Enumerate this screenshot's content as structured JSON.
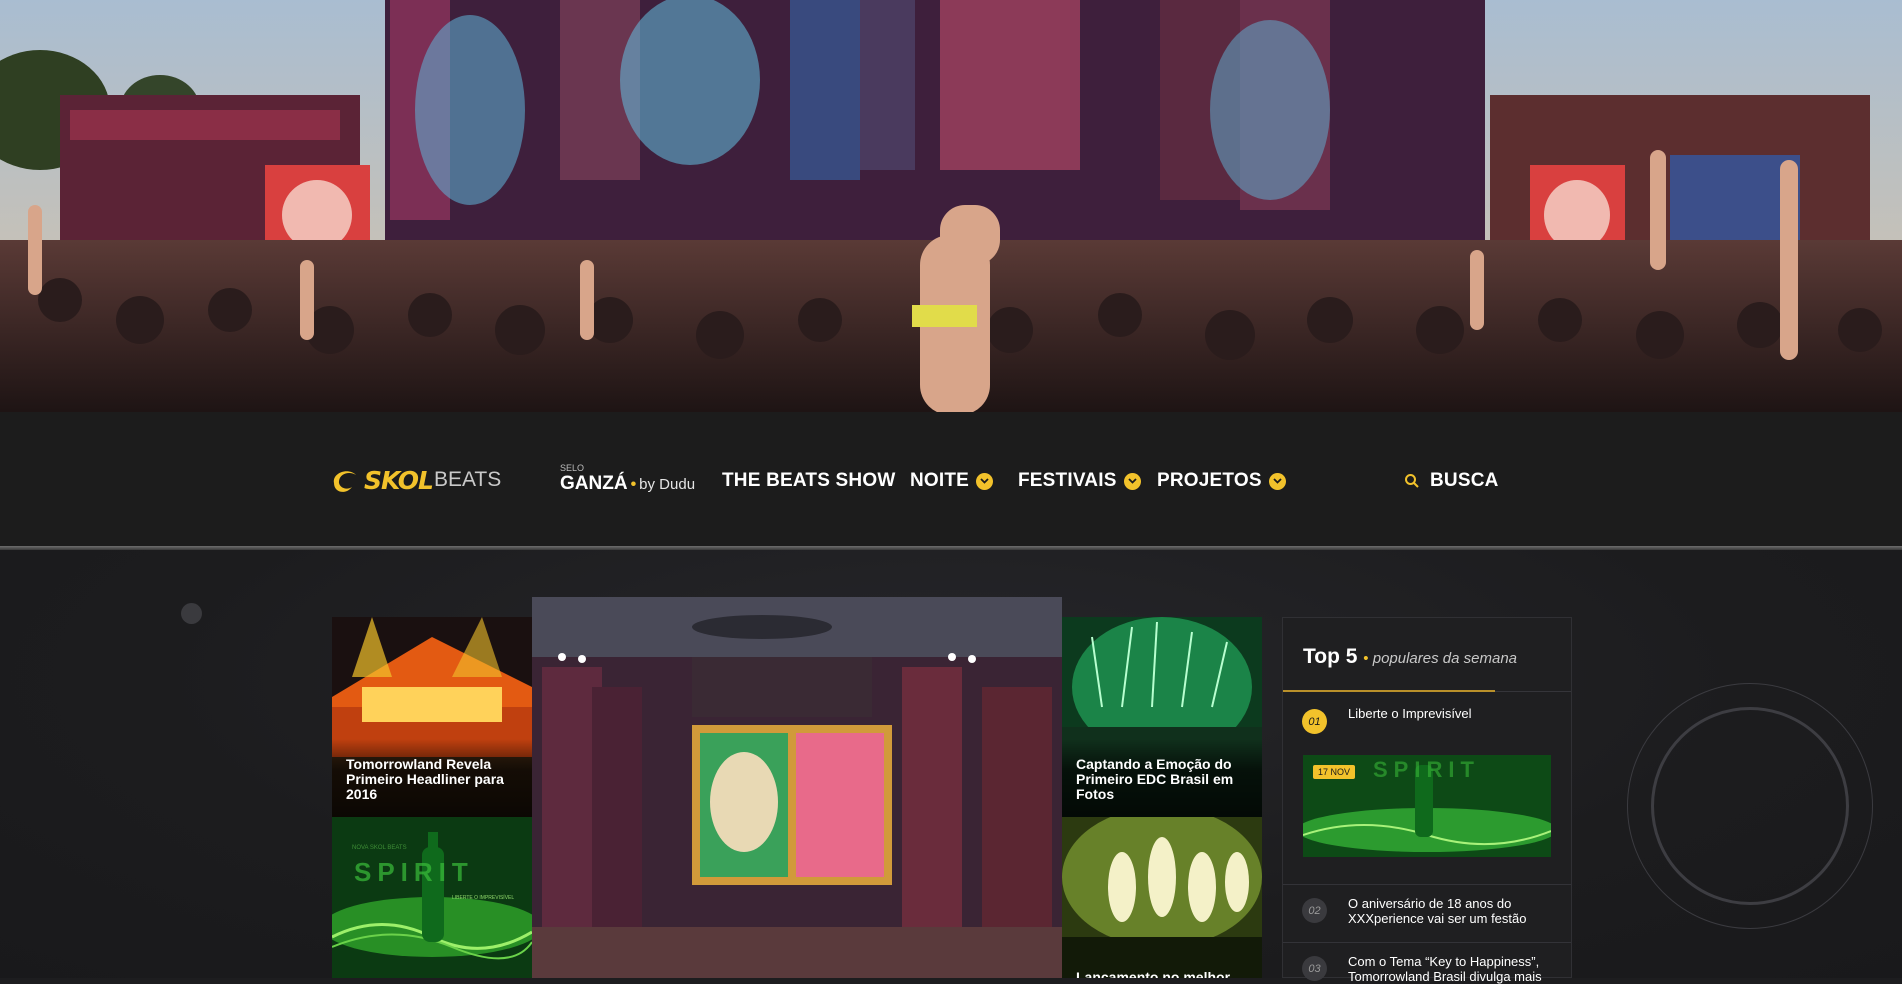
{
  "brand": {
    "logo_primary": "SKOL",
    "logo_secondary": "BEATS",
    "accent": "#f2c22b"
  },
  "nav": {
    "selo_label": "SELO",
    "ganza_label": "GANZÁ",
    "ganza_bullet": "•",
    "ganza_by": "by Dudu",
    "items": [
      {
        "label": "THE BEATS SHOW",
        "has_dropdown": false
      },
      {
        "label": "NOITE",
        "has_dropdown": true
      },
      {
        "label": "FESTIVAIS",
        "has_dropdown": true
      },
      {
        "label": "PROJETOS",
        "has_dropdown": true
      }
    ],
    "search_label": "BUSCA"
  },
  "features": [
    {
      "caption": "Tomorrowland Revela Primeiro Headliner para 2016"
    },
    {
      "caption": "Captando a Emoção do Primeiro EDC Brasil em Fotos"
    },
    {
      "caption": "Lançamento no melhor"
    }
  ],
  "spirit_ad": {
    "text": "SPIRIT",
    "subtitle": "NOVA SKOL BEATS",
    "tagline": "LIBERTE O IMPREVISÍVEL"
  },
  "top5": {
    "title": "Top 5",
    "bullet": "•",
    "subtitle": "populares da semana",
    "items": [
      {
        "rank": "01",
        "title": "Liberte o Imprevisível",
        "date": "17 NOV"
      },
      {
        "rank": "02",
        "title": "O aniversário de 18 anos do XXXperience vai ser um festão"
      },
      {
        "rank": "03",
        "title": "Com o Tema “Key to Happiness”, Tomorrowland Brasil divulga mais"
      }
    ]
  },
  "icons": {
    "dropdown": "chevron-down-icon",
    "search": "search-icon",
    "logo": "skol-swirl-icon"
  }
}
